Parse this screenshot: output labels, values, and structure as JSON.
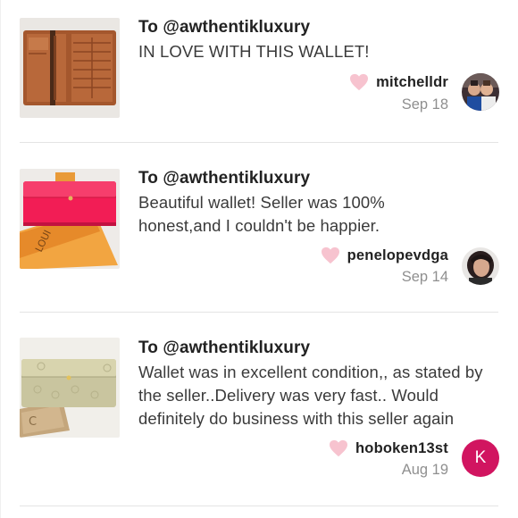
{
  "reviews": [
    {
      "to": "To @awthentikluxury",
      "text": "IN LOVE WITH THIS WALLET!",
      "username": "mitchelldr",
      "date": "Sep 18",
      "avatar_type": "photo"
    },
    {
      "to": "To @awthentikluxury",
      "text": "Beautiful wallet! Seller was 100% honest,and I couldn't be happier.",
      "username": "penelopevdga",
      "date": "Sep 14",
      "avatar_type": "photo"
    },
    {
      "to": "To @awthentikluxury",
      "text": "Wallet was in excellent condition,, as stated by the seller..Delivery was very fast.. Would definitely do business with this seller again",
      "username": "hoboken13st",
      "date": "Aug 19",
      "avatar_type": "letter",
      "avatar_letter": "K"
    }
  ],
  "colors": {
    "heart": "#f7c3cf",
    "avatar_letter_bg": "#d11560",
    "divider": "#e4e4e4",
    "date_text": "#8f8f8f"
  },
  "icons": {
    "like": "heart-icon"
  },
  "images": [
    "brown-leather-wallet-open",
    "pink-wallet-on-orange-box",
    "gold-monogram-wallet"
  ]
}
